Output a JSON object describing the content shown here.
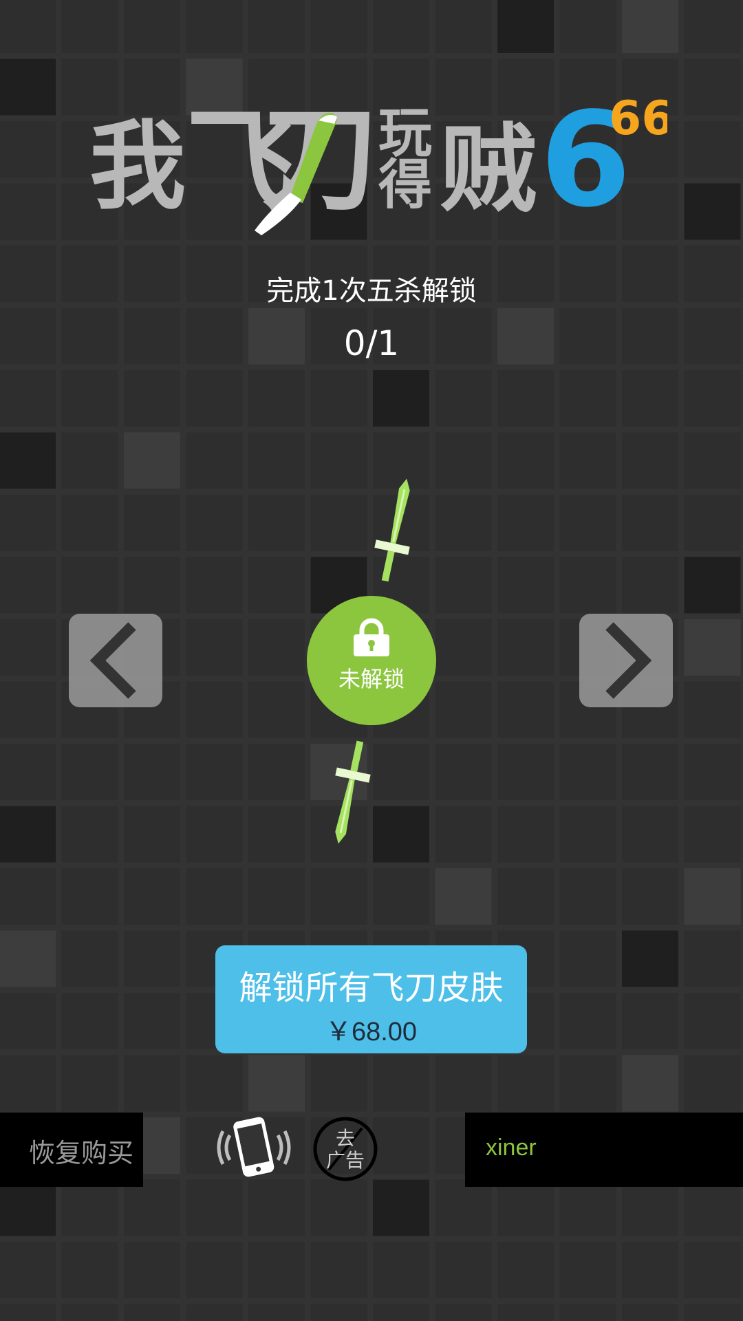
{
  "logo": {
    "title_chars": [
      "我",
      "飞",
      "刀",
      "玩",
      "得",
      "贼"
    ],
    "title_mark": "6",
    "superscript": "66"
  },
  "skin": {
    "requirement": "完成1次五杀解锁",
    "progress": "0/1",
    "lock_label": "未解锁"
  },
  "nav": {
    "prev_icon": "chevron-left-icon",
    "next_icon": "chevron-right-icon"
  },
  "purchase": {
    "title": "解锁所有飞刀皮肤",
    "price": "￥68.00"
  },
  "footer": {
    "restore_label": "恢复购买",
    "vibrate_icon": "vibrate-phone-icon",
    "no_ads_text": [
      "去",
      "广告"
    ],
    "player_name": "xiner"
  },
  "colors": {
    "background": "#333333",
    "accent_green": "#8cc63f",
    "button_blue": "#4dbfe9",
    "logo_blue": "#1f9ee0",
    "logo_orange": "#f7a51c",
    "logo_red": "#e8462b"
  }
}
